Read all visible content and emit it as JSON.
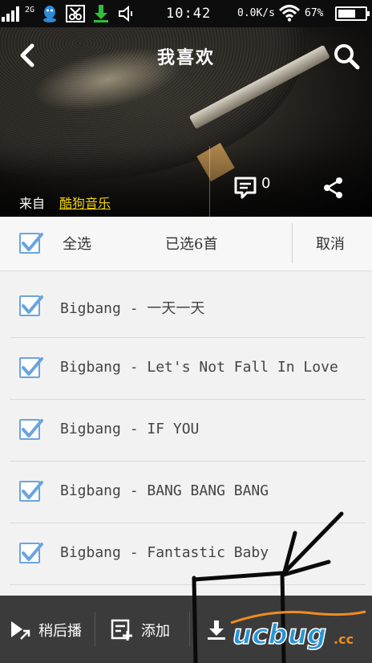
{
  "status_bar": {
    "network_type": "2G",
    "time": "10:42",
    "speed": "0.0K/s",
    "battery_percent": "67%",
    "battery_level": 0.67,
    "icons": [
      "signal-icon",
      "qq-icon",
      "scissors-icon",
      "download-icon",
      "volume-icon",
      "wifi-icon",
      "battery-icon"
    ]
  },
  "header": {
    "title": "我喜欢",
    "source_label": "来自",
    "source_name": "酷狗音乐",
    "comment_count": "0",
    "source_color": "#f2d300"
  },
  "selection_bar": {
    "select_all_label": "全选",
    "selected_count_label": "已选6首",
    "cancel_label": "取消",
    "select_all_checked": true
  },
  "songs": [
    {
      "title": "Bigbang - 一天一天",
      "checked": true
    },
    {
      "title": "Bigbang - Let's Not Fall In Love",
      "checked": true
    },
    {
      "title": "Bigbang - IF YOU",
      "checked": true
    },
    {
      "title": "Bigbang - BANG BANG BANG",
      "checked": true
    },
    {
      "title": "Bigbang - Fantastic Baby",
      "checked": true
    }
  ],
  "bottom_toolbar": {
    "play_next_label": "稍后播",
    "add_label": "添加"
  },
  "colors": {
    "checkbox_accent": "#6aa4e0",
    "toolbar_bg": "#3b3b3b"
  }
}
